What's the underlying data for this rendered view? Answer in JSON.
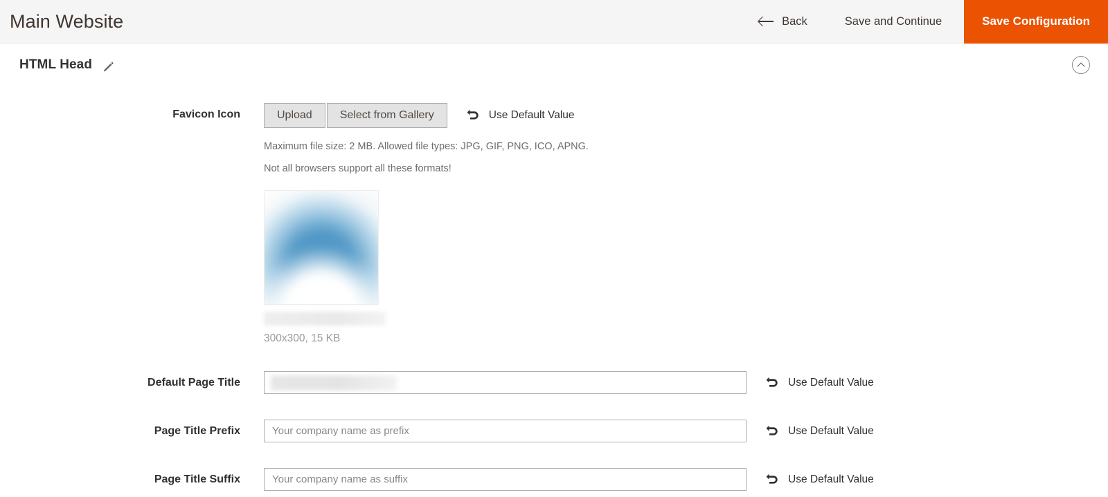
{
  "header": {
    "title": "Main Website",
    "back_label": "Back",
    "save_continue_label": "Save and Continue",
    "save_config_label": "Save Configuration",
    "accent_color": "#eb5202",
    "background_color": "#f5f5f5",
    "back_icon": "arrow-left-icon"
  },
  "section": {
    "title": "HTML Head",
    "edit_icon": "pencil-icon",
    "collapse_icon": "chevron-up-icon"
  },
  "fields": {
    "favicon": {
      "label": "Favicon Icon",
      "upload_label": "Upload",
      "gallery_label": "Select from Gallery",
      "use_default_label": "Use Default Value",
      "use_default_icon": "undo-icon",
      "note_1": "Maximum file size: 2 MB. Allowed file types: JPG, GIF, PNG, ICO, APNG.",
      "note_2": "Not all browsers support all these formats!",
      "preview_meta": "300x300, 15 KB",
      "preview_color": "#4a94c4"
    },
    "default_page_title": {
      "label": "Default Page Title",
      "value": "",
      "placeholder": "",
      "use_default_label": "Use Default Value",
      "use_default_icon": "undo-icon"
    },
    "page_title_prefix": {
      "label": "Page Title Prefix",
      "value": "",
      "placeholder": "Your company name as prefix",
      "use_default_label": "Use Default Value",
      "use_default_icon": "undo-icon"
    },
    "page_title_suffix": {
      "label": "Page Title Suffix",
      "value": "",
      "placeholder": "Your company name as suffix",
      "use_default_label": "Use Default Value",
      "use_default_icon": "undo-icon"
    }
  }
}
